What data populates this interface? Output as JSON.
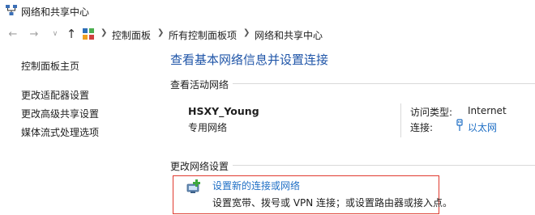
{
  "window": {
    "title": "网络和共享中心"
  },
  "breadcrumb": [
    "控制面板",
    "所有控制面板项",
    "网络和共享中心"
  ],
  "sidebar": {
    "home": "控制面板主页",
    "items": [
      "更改适配器设置",
      "更改高级共享设置",
      "媒体流式处理选项"
    ]
  },
  "main": {
    "title": "查看基本网络信息并设置连接",
    "active_header": "查看活动网络",
    "network": {
      "name": "HSXY_Young",
      "type": "专用网络",
      "access_label": "访问类型:",
      "access_value": "Internet",
      "conn_label": "连接:",
      "conn_value": "以太网"
    },
    "change_header": "更改网络设置",
    "setup": {
      "title": "设置新的连接或网络",
      "desc": "设置宽带、拨号或 VPN 连接；或设置路由器或接入点。"
    }
  },
  "colors": {
    "link": "#1f6fc5",
    "title": "#1f55a8",
    "highlight": "#e03a2f"
  }
}
